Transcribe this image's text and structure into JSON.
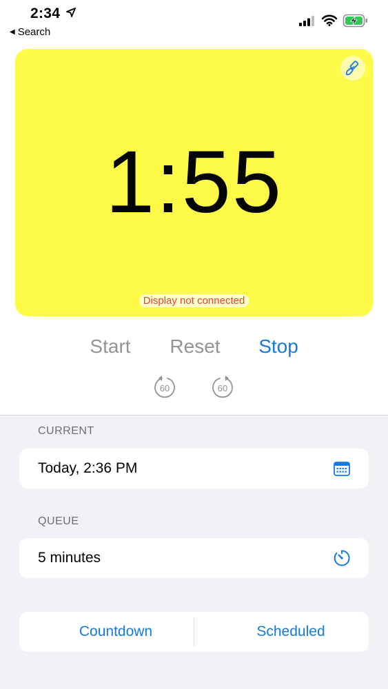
{
  "status_bar": {
    "time": "2:34",
    "back_label": "Search",
    "location_icon": "location-arrow-icon",
    "signal_icon": "cellular-signal-icon",
    "wifi_icon": "wifi-icon",
    "battery_icon": "battery-charging-icon",
    "battery_color": "#34c759"
  },
  "display": {
    "time": "1:55",
    "connection_status": "Display not connected",
    "background_color": "#fdfb47",
    "paint_icon": "paintbrush-icon"
  },
  "controls": {
    "start_label": "Start",
    "reset_label": "Reset",
    "stop_label": "Stop",
    "skip_back_label": "60",
    "skip_forward_label": "60",
    "skip_back_icon": "rewind-60-icon",
    "skip_forward_icon": "forward-60-icon",
    "accent_color": "#1479e0",
    "disabled_color": "#939397"
  },
  "current": {
    "header": "CURRENT",
    "value": "Today, 2:36 PM",
    "icon": "calendar-icon"
  },
  "queue": {
    "header": "QUEUE",
    "value": "5 minutes",
    "icon": "timer-icon"
  },
  "mode": {
    "countdown_label": "Countdown",
    "scheduled_label": "Scheduled"
  }
}
